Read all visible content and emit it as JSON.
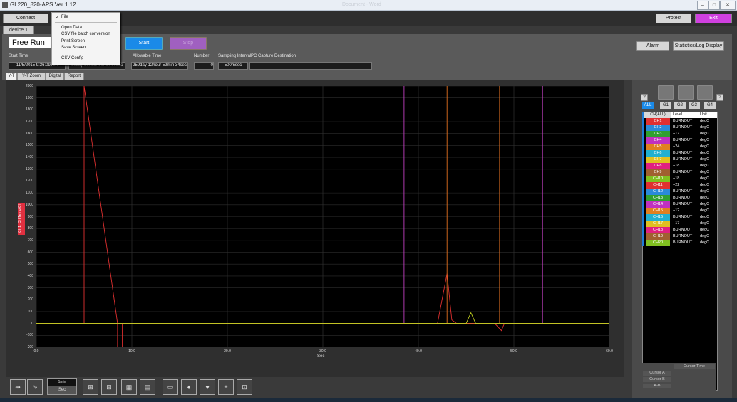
{
  "window": {
    "title": "GL220_820-APS Ver 1.12",
    "center_title": "Document - Word"
  },
  "topbar": {
    "connect": "Connect",
    "protect": "Protect",
    "exit": "Exit"
  },
  "device_tab": "device 1",
  "file_menu": {
    "header": "File",
    "items": [
      "Open Data",
      "CSV file batch conversion",
      "Print Screen",
      "Save Screen",
      "CSV Config"
    ]
  },
  "control": {
    "mode": "Free Run",
    "start": "Start",
    "stop": "Stop",
    "alarm": "Alarm",
    "stats": "Statistics/Log Display",
    "start_time_label": "Start Time",
    "start_time": "11/5/2015 9:36:09 AM",
    "elapsed": "00day 00hour 00min 00sec",
    "allowable_label": "Allowable Time",
    "allowable": "259day 12hour 59min 34sec",
    "number_label": "Number",
    "number": "0",
    "interval_label": "Sampling Interval",
    "interval": "500msec",
    "dest_label": "PC Capture Destination",
    "dest": ""
  },
  "subtabs": [
    "Y-T",
    "Y-T Zoom",
    "Digital",
    "Report"
  ],
  "chart": {
    "ylabel": "CH1: CH Temp[C]",
    "xlabel": "Sec"
  },
  "chart_data": {
    "type": "line",
    "xlabel": "Sec",
    "ylabel": "CH1: CH Temp[C]",
    "xlim": [
      0,
      60
    ],
    "ylim": [
      -200,
      2000
    ],
    "xticks": [
      "0.0",
      "10.0",
      "20.0",
      "30.0",
      "40.0",
      "50.0",
      "60.0"
    ],
    "yticks": [
      "2000",
      "1900",
      "1800",
      "1700",
      "1600",
      "1500",
      "1400",
      "1300",
      "1200",
      "1100",
      "1000",
      "900",
      "800",
      "700",
      "600",
      "500",
      "400",
      "300",
      "200",
      "100",
      "0",
      "-100",
      "-200"
    ],
    "series": [
      {
        "color": "#e03030",
        "x": [
          0,
          5,
          5,
          8.5,
          8.5,
          9,
          9,
          42,
          43,
          43.5,
          44,
          44.5,
          48,
          48.7,
          49,
          60
        ],
        "y": [
          0,
          0,
          2000,
          0,
          -200,
          -200,
          0,
          0,
          420,
          30,
          0,
          0,
          0,
          -60,
          0,
          0
        ]
      },
      {
        "color": "#c040c0",
        "x": [
          0,
          38.5,
          38.5,
          38.5,
          53,
          53,
          53,
          60
        ],
        "y": [
          0,
          0,
          2000,
          0,
          0,
          2000,
          0,
          0
        ]
      },
      {
        "color": "#e07020",
        "x": [
          0,
          43,
          43,
          43,
          48.5,
          48.5,
          48.5,
          60
        ],
        "y": [
          0,
          0,
          2000,
          0,
          0,
          2000,
          0,
          0
        ]
      },
      {
        "color": "#c0d020",
        "x": [
          0,
          45,
          45.5,
          46,
          60
        ],
        "y": [
          0,
          0,
          90,
          0,
          0
        ]
      }
    ]
  },
  "rightpanel": {
    "groups": [
      "ALL",
      "G1",
      "G2",
      "G3",
      "G4"
    ],
    "headers": [
      "CH(ALL)",
      "Level",
      "Unit"
    ],
    "rows": [
      {
        "ch": "CH1",
        "lv": "BURNOUT",
        "u": "degC",
        "c": "#e03030"
      },
      {
        "ch": "CH2",
        "lv": "BURNOUT",
        "u": "degC",
        "c": "#2a8ad8"
      },
      {
        "ch": "CH3",
        "lv": "+17",
        "u": "degC",
        "c": "#30a030"
      },
      {
        "ch": "CH4",
        "lv": "BURNOUT",
        "u": "degC",
        "c": "#c030c0"
      },
      {
        "ch": "CH5",
        "lv": "+24",
        "u": "degC",
        "c": "#e08020"
      },
      {
        "ch": "CH6",
        "lv": "BURNOUT",
        "u": "degC",
        "c": "#20b0d0"
      },
      {
        "ch": "CH7",
        "lv": "BURNOUT",
        "u": "degC",
        "c": "#e0c020"
      },
      {
        "ch": "CH8",
        "lv": "+18",
        "u": "degC",
        "c": "#e02080"
      },
      {
        "ch": "CH9",
        "lv": "BURNOUT",
        "u": "degC",
        "c": "#a06030"
      },
      {
        "ch": "CH10",
        "lv": "+18",
        "u": "degC",
        "c": "#80c020"
      },
      {
        "ch": "CH11",
        "lv": "+22",
        "u": "degC",
        "c": "#e03030"
      },
      {
        "ch": "CH12",
        "lv": "BURNOUT",
        "u": "degC",
        "c": "#2a8ad8"
      },
      {
        "ch": "CH13",
        "lv": "BURNOUT",
        "u": "degC",
        "c": "#30a030"
      },
      {
        "ch": "CH14",
        "lv": "BURNOUT",
        "u": "degC",
        "c": "#c030c0"
      },
      {
        "ch": "CH15",
        "lv": "+12",
        "u": "degC",
        "c": "#e08020"
      },
      {
        "ch": "CH16",
        "lv": "BURNOUT",
        "u": "degC",
        "c": "#20b0d0"
      },
      {
        "ch": "CH17",
        "lv": "+17",
        "u": "degC",
        "c": "#e0c020"
      },
      {
        "ch": "CH18",
        "lv": "BURNOUT",
        "u": "degC",
        "c": "#e02080"
      },
      {
        "ch": "CH19",
        "lv": "BURNOUT",
        "u": "degC",
        "c": "#a06030"
      },
      {
        "ch": "CH20",
        "lv": "BURNOUT",
        "u": "degC",
        "c": "#80c020"
      }
    ],
    "cursor_time": "Cursor Time",
    "cursor_a": "Cursor A",
    "cursor_b": "Cursor B",
    "cursor_ab": "A-B"
  },
  "bottom": {
    "time_unit": "Sec",
    "span": "1min"
  }
}
